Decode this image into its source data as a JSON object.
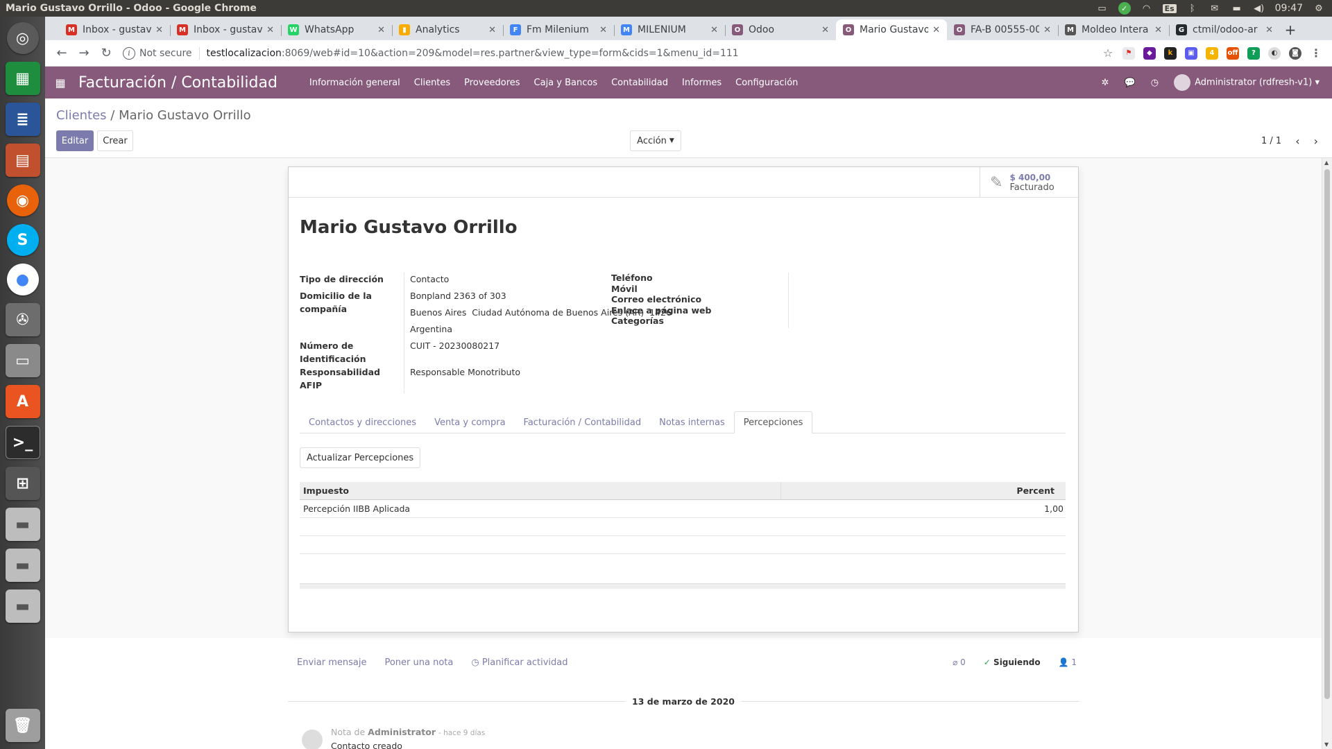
{
  "os": {
    "window_title": "Mario Gustavo Orrillo - Odoo - Google Chrome",
    "lang": "Es",
    "clock": "09:47"
  },
  "browser": {
    "tabs": [
      {
        "label": "Inbox - gustav",
        "color": "#d93025",
        "glyph": "M"
      },
      {
        "label": "Inbox - gustav",
        "color": "#d93025",
        "glyph": "M"
      },
      {
        "label": "WhatsApp",
        "color": "#25d366",
        "glyph": "W"
      },
      {
        "label": "Analytics",
        "color": "#f9ab00",
        "glyph": "▮"
      },
      {
        "label": "Fm Milenium",
        "color": "#4285f4",
        "glyph": "F"
      },
      {
        "label": "MILENIUM",
        "color": "#4285f4",
        "glyph": "M"
      },
      {
        "label": "Odoo",
        "color": "#875a7b",
        "glyph": "O"
      },
      {
        "label": "Mario Gustavo",
        "color": "#875a7b",
        "glyph": "O"
      },
      {
        "label": "FA-B 00555-00",
        "color": "#875a7b",
        "glyph": "O"
      },
      {
        "label": "Moldeo Intera",
        "color": "#555555",
        "glyph": "M"
      },
      {
        "label": "ctmil/odoo-ar",
        "color": "#24292e",
        "glyph": "G"
      }
    ],
    "active_tab_index": 7,
    "url": {
      "not_secure": "Not secure",
      "host": "testlocalizacion",
      "path": ":8069/web#id=10&action=209&model=res.partner&view_type=form&cids=1&menu_id=111"
    }
  },
  "odoo": {
    "app_title": "Facturación / Contabilidad",
    "menu": [
      "Información general",
      "Clientes",
      "Proveedores",
      "Caja y Bancos",
      "Contabilidad",
      "Informes",
      "Configuración"
    ],
    "user": "Administrator (rdfresh-v1)",
    "breadcrumb": {
      "parent": "Clientes",
      "sep": "/",
      "current": "Mario Gustavo Orrillo"
    },
    "buttons": {
      "edit": "Editar",
      "create": "Crear",
      "action": "Acción"
    },
    "pager": "1 / 1",
    "stat": {
      "value": "$ 400,00",
      "label": "Facturado"
    },
    "partner_name": "Mario Gustavo Orrillo",
    "fields_left": {
      "address_type_label": "Tipo de dirección",
      "address_type_value": "Contacto",
      "company_address_label_1": "Domicilio de la",
      "company_address_label_2": "compañía",
      "street": "Bonpland 2363 of 303",
      "city_line": "Buenos Aires  Ciudad Autónoma de Buenos Aires (AR)  1426",
      "country": "Argentina",
      "id_number_label_1": "Número de",
      "id_number_label_2": "Identificación",
      "id_number_value": "CUIT - 20230080217",
      "afip_label_1": "Responsabilidad",
      "afip_label_2": "AFIP",
      "afip_value": "Responsable Monotributo"
    },
    "fields_right": [
      "Teléfono",
      "Móvil",
      "Correo electrónico",
      "Enlace a página web",
      "Categorías"
    ],
    "notebook_tabs": [
      "Contactos y direcciones",
      "Venta y compra",
      "Facturación / Contabilidad",
      "Notas internas",
      "Percepciones"
    ],
    "active_notebook_tab": 4,
    "update_button": "Actualizar Percepciones",
    "table": {
      "headers": [
        "Impuesto",
        "Percent"
      ],
      "rows": [
        [
          "Percepción IIBB Aplicada",
          "1,00"
        ]
      ]
    },
    "chatter": {
      "send_message": "Enviar mensaje",
      "log_note": "Poner una nota",
      "schedule": "Planificar actividad",
      "attachments": "0",
      "following": "Siguiendo",
      "followers": "1",
      "date": "13 de marzo de 2020",
      "msg_prefix": "Nota de",
      "msg_author": "Administrator",
      "msg_ago": "- hace 9 días",
      "msg_body": "Contacto creado"
    }
  }
}
